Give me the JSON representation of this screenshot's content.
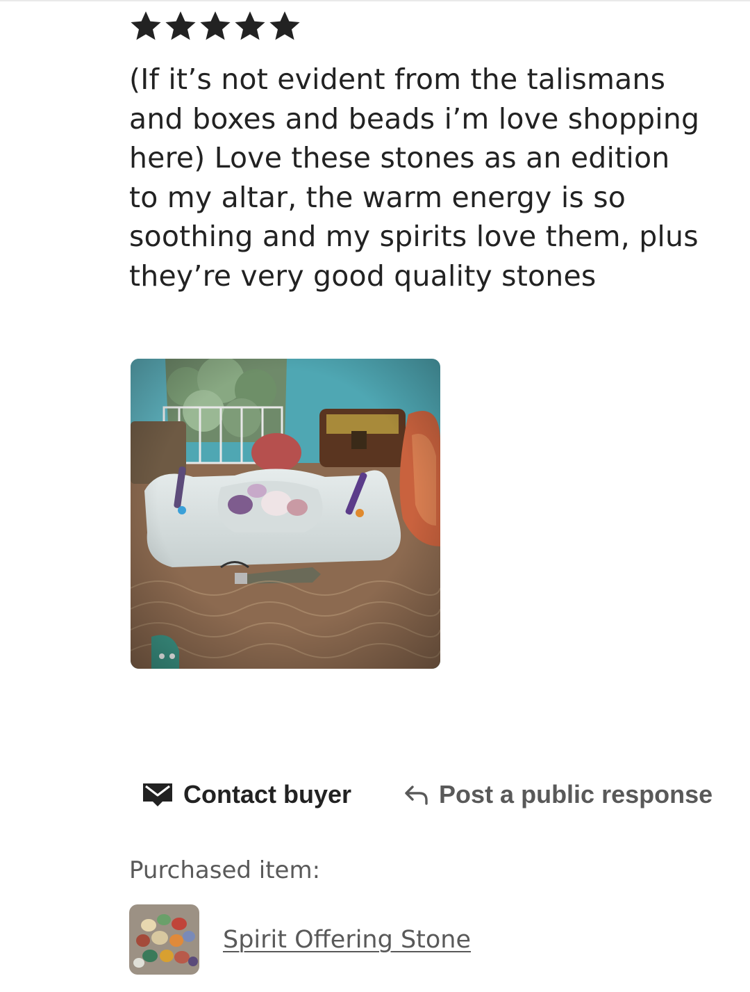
{
  "review": {
    "rating": 5,
    "rating_max": 5,
    "text": "(If it’s not evident from the talismans and boxes and beads i’m love shopping here) Love these stones as an edition to my altar, the warm energy is so soothing and my spirits love them, plus they’re very good quality stones"
  },
  "actions": {
    "contact_buyer_label": "Contact buyer",
    "public_response_label": "Post a public response"
  },
  "purchased": {
    "label": "Purchased item:",
    "item_name": "Spirit Offering Stone"
  },
  "icons": {
    "star": "star-icon",
    "contact": "envelope-icon",
    "response": "reply-arrow-icon"
  },
  "colors": {
    "text_primary": "#222222",
    "text_secondary": "#595959"
  }
}
